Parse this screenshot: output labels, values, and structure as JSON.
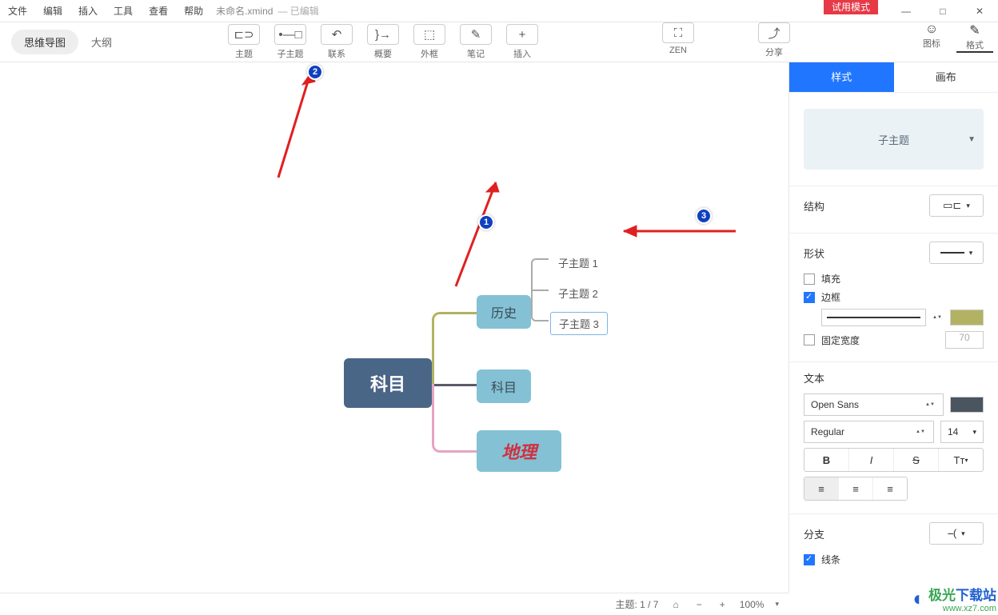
{
  "menu": {
    "file": "文件",
    "edit": "编辑",
    "insert": "插入",
    "tools": "工具",
    "view": "查看",
    "help": "帮助"
  },
  "file_label": "未命名.xmind",
  "edited_label": "— 已编辑",
  "trial_badge": "试用模式",
  "window_controls": {
    "min": "—",
    "max": "□",
    "close": "✕"
  },
  "view_tabs": {
    "mindmap": "思维导图",
    "outline": "大纲"
  },
  "toolbar": {
    "topic": "主题",
    "subtopic": "子主题",
    "relation": "联系",
    "summary": "概要",
    "boundary": "外框",
    "notes": "笔记",
    "insert": "插入",
    "zen": "ZEN",
    "share": "分享",
    "icons": "图标",
    "format": "格式"
  },
  "nodes": {
    "root": "科目",
    "history": "历史",
    "subject": "科目",
    "geography": "地理",
    "sub1": "子主题 1",
    "sub2": "子主题 2",
    "sub3": "子主题 3"
  },
  "annotations": {
    "b1": "1",
    "b2": "2",
    "b3": "3"
  },
  "panel": {
    "tabs": {
      "style": "样式",
      "canvas": "画布"
    },
    "preview_label": "子主题",
    "structure": "结构",
    "shape": "形状",
    "fill": "填充",
    "border": "边框",
    "fixed_width": "固定宽度",
    "fixed_width_val": "70",
    "text": "文本",
    "font_family": "Open Sans",
    "font_weight": "Regular",
    "font_size": "14",
    "bold": "B",
    "italic": "I",
    "strike": "S",
    "textcase": "Tᴛ",
    "branch": "分支",
    "line": "线条"
  },
  "statusbar": {
    "topic_count": "主题: 1 / 7",
    "zoom": "100%"
  },
  "watermark": {
    "name1": "极光",
    "name2": "下载站",
    "url": "www.xz7.com"
  }
}
